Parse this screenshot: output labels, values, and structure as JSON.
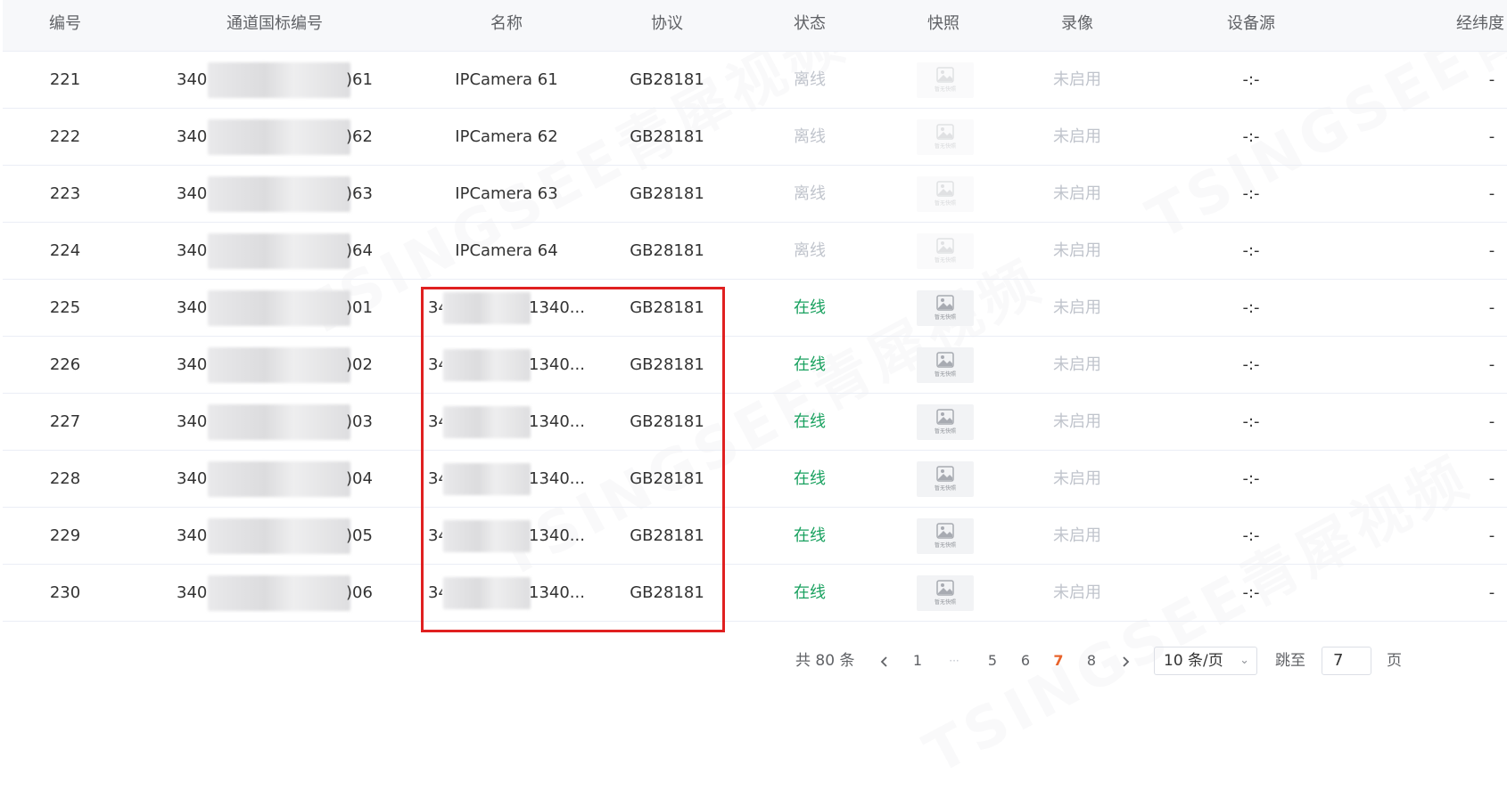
{
  "columns": [
    "编号",
    "通道国标编号",
    "名称",
    "协议",
    "状态",
    "快照",
    "录像",
    "设备源",
    "经纬度"
  ],
  "rows": [
    {
      "id": "221",
      "gb_prefix": "340",
      "gb_suffix": ")61",
      "name": "IPCamera 61",
      "protocol": "GB28181",
      "status": "离线",
      "online": false,
      "record": "未启用",
      "source": "-:-",
      "latlng": "-"
    },
    {
      "id": "222",
      "gb_prefix": "340",
      "gb_suffix": ")62",
      "name": "IPCamera 62",
      "protocol": "GB28181",
      "status": "离线",
      "online": false,
      "record": "未启用",
      "source": "-:-",
      "latlng": "-"
    },
    {
      "id": "223",
      "gb_prefix": "340",
      "gb_suffix": ")63",
      "name": "IPCamera 63",
      "protocol": "GB28181",
      "status": "离线",
      "online": false,
      "record": "未启用",
      "source": "-:-",
      "latlng": "-"
    },
    {
      "id": "224",
      "gb_prefix": "340",
      "gb_suffix": ")64",
      "name": "IPCamera 64",
      "protocol": "GB28181",
      "status": "离线",
      "online": false,
      "record": "未启用",
      "source": "-:-",
      "latlng": "-"
    },
    {
      "id": "225",
      "gb_prefix": "340",
      "gb_suffix": ")01",
      "name_prefix": "34",
      "name": "1340...",
      "protocol": "GB28181",
      "status": "在线",
      "online": true,
      "record": "未启用",
      "source": "-:-",
      "latlng": "-"
    },
    {
      "id": "226",
      "gb_prefix": "340",
      "gb_suffix": ")02",
      "name_prefix": "34",
      "name": "1340...",
      "protocol": "GB28181",
      "status": "在线",
      "online": true,
      "record": "未启用",
      "source": "-:-",
      "latlng": "-"
    },
    {
      "id": "227",
      "gb_prefix": "340",
      "gb_suffix": ")03",
      "name_prefix": "34",
      "name": "1340...",
      "protocol": "GB28181",
      "status": "在线",
      "online": true,
      "record": "未启用",
      "source": "-:-",
      "latlng": "-"
    },
    {
      "id": "228",
      "gb_prefix": "340",
      "gb_suffix": ")04",
      "name_prefix": "34",
      "name": "1340...",
      "protocol": "GB28181",
      "status": "在线",
      "online": true,
      "record": "未启用",
      "source": "-:-",
      "latlng": "-"
    },
    {
      "id": "229",
      "gb_prefix": "340",
      "gb_suffix": ")05",
      "name_prefix": "34",
      "name": "1340...",
      "protocol": "GB28181",
      "status": "在线",
      "online": true,
      "record": "未启用",
      "source": "-:-",
      "latlng": "-"
    },
    {
      "id": "230",
      "gb_prefix": "340",
      "gb_suffix": ")06",
      "name_prefix": "34",
      "name": "1340...",
      "protocol": "GB28181",
      "status": "在线",
      "online": true,
      "record": "未启用",
      "source": "-:-",
      "latlng": "-"
    }
  ],
  "snapshot_placeholder": "暂无快照",
  "snapshot_icon": "image-placeholder-icon",
  "pagination": {
    "total": "共 80 条",
    "prev_icon": "chevron-left-icon",
    "next_icon": "chevron-right-icon",
    "pages": [
      "1",
      "···",
      "5",
      "6",
      "7",
      "8"
    ],
    "current": "7",
    "page_size": "10 条/页",
    "jump_label": "跳至",
    "jump_value": "7",
    "page_unit": "页"
  },
  "watermark": "TSINGSEE青犀视频",
  "colors": {
    "online": "#19a15f",
    "offline": "#c0c4cc",
    "active_page": "#e8632b",
    "highlight": "#e02020"
  }
}
